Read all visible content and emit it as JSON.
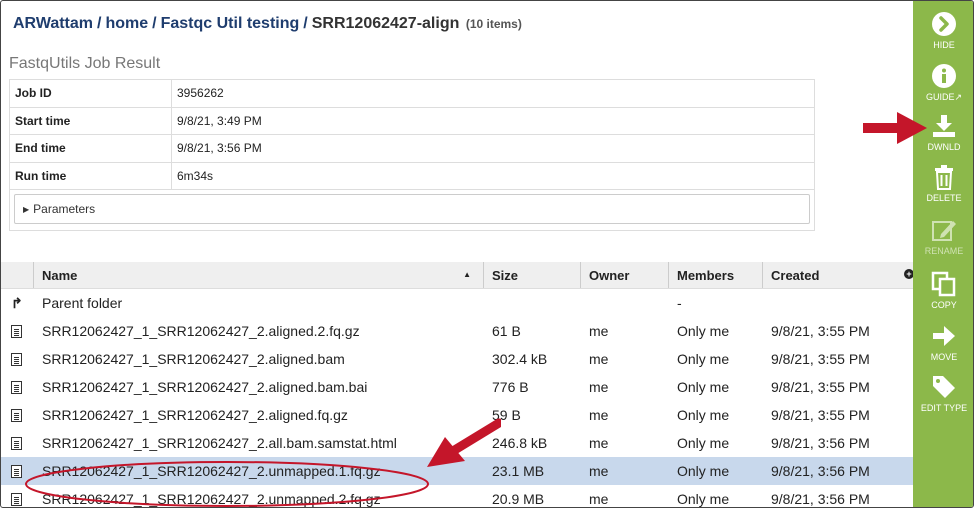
{
  "breadcrumb": {
    "items": [
      "ARWattam",
      "home",
      "Fastqc Util testing"
    ],
    "current": "SRR12062427-align",
    "count": "(10 items)"
  },
  "job": {
    "title": "FastqUtils Job Result",
    "rows": [
      {
        "label": "Job ID",
        "value": "3956262"
      },
      {
        "label": "Start time",
        "value": "9/8/21, 3:49 PM"
      },
      {
        "label": "End time",
        "value": "9/8/21, 3:56 PM"
      },
      {
        "label": "Run time",
        "value": "6m34s"
      }
    ],
    "parameters_label": "Parameters"
  },
  "grid": {
    "columns": {
      "name": "Name",
      "size": "Size",
      "owner": "Owner",
      "members": "Members",
      "created": "Created"
    },
    "parent": {
      "name": "Parent folder",
      "members": "-"
    },
    "rows": [
      {
        "name": "SRR12062427_1_SRR12062427_2.aligned.2.fq.gz",
        "size": "61 B",
        "owner": "me",
        "members": "Only me",
        "created": "9/8/21, 3:55 PM"
      },
      {
        "name": "SRR12062427_1_SRR12062427_2.aligned.bam",
        "size": "302.4 kB",
        "owner": "me",
        "members": "Only me",
        "created": "9/8/21, 3:55 PM"
      },
      {
        "name": "SRR12062427_1_SRR12062427_2.aligned.bam.bai",
        "size": "776 B",
        "owner": "me",
        "members": "Only me",
        "created": "9/8/21, 3:55 PM"
      },
      {
        "name": "SRR12062427_1_SRR12062427_2.aligned.fq.gz",
        "size": "59 B",
        "owner": "me",
        "members": "Only me",
        "created": "9/8/21, 3:55 PM"
      },
      {
        "name": "SRR12062427_1_SRR12062427_2.all.bam.samstat.html",
        "size": "246.8 kB",
        "owner": "me",
        "members": "Only me",
        "created": "9/8/21, 3:56 PM"
      },
      {
        "name": "SRR12062427_1_SRR12062427_2.unmapped.1.fq.gz",
        "size": "23.1 MB",
        "owner": "me",
        "members": "Only me",
        "created": "9/8/21, 3:56 PM"
      },
      {
        "name": "SRR12062427_1_SRR12062427_2.unmapped.2.fq.gz",
        "size": "20.9 MB",
        "owner": "me",
        "members": "Only me",
        "created": "9/8/21, 3:56 PM"
      }
    ]
  },
  "sidebar": {
    "hide": "HIDE",
    "guide": "GUIDE",
    "download": "DWNLD",
    "delete": "DELETE",
    "rename": "RENAME",
    "copy": "COPY",
    "move": "MOVE",
    "edit_type": "EDIT TYPE"
  },
  "colors": {
    "sidebar": "#8cb84a",
    "breadcrumb": "#1f3d6e",
    "selected_row": "#c8d8ec",
    "annotation": "#c4162a"
  },
  "icons": [
    "chevron-right-icon",
    "info-icon",
    "external-link-icon",
    "download-icon",
    "trash-icon",
    "pencil-icon",
    "copy-icon",
    "arrow-right-icon",
    "tag-icon",
    "file-icon",
    "up-arrow-icon",
    "sort-up-icon",
    "plus-circle-icon"
  ]
}
